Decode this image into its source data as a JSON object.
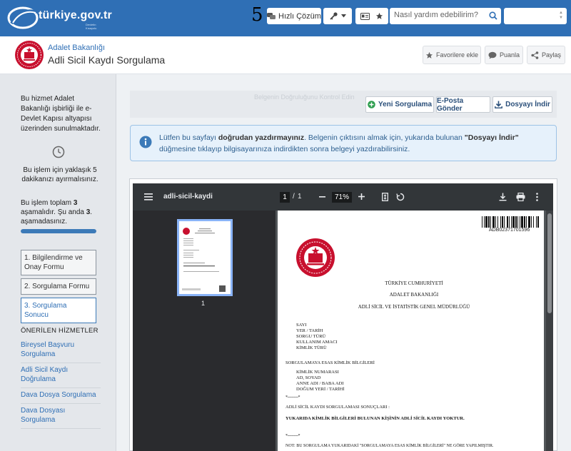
{
  "header": {
    "logo_text": "türkiye.gov.tr",
    "logo_sub": "Devletin Kısayolu",
    "step_number": "5",
    "hizli_cozum": "Hızlı Çözüm",
    "search_placeholder": "Nasıl yardım edebilirim?",
    "language": ""
  },
  "subheader": {
    "ministry": "Adalet Bakanlığı",
    "title": "Adli Sicil Kaydı Sorgulama",
    "favorites": "Favorilere ekle",
    "rate": "Puanla",
    "share": "Paylaş"
  },
  "sidebar": {
    "info": "Bu hizmet Adalet Bakanlığı işbirliği ile e-Devlet Kapısı altyapısı üzerinden sunulmaktadır.",
    "duration": "Bu işlem için yaklaşık 5 dakikanızı ayırmalısınız.",
    "stages_pre": "Bu işlem toplam ",
    "stages_total": "3",
    "stages_mid": " aşamalıdır. Şu anda ",
    "stages_current": "3",
    "stages_post": ". aşamadasınız.",
    "progress_percent": 100,
    "steps": [
      "1. Bilgilendirme ve Onay Formu",
      "2. Sorgulama Formu",
      "3. Sorgulama Sonucu"
    ],
    "recommended_title": "ÖNERİLEN HİZMETLER",
    "recommended": [
      "Bireysel Başvuru Sorgulama",
      "Adli Sicil Kaydı Doğrulama",
      "Dava Dosya Sorgulama",
      "Dava Dosyası Sorgulama"
    ]
  },
  "toolbar": {
    "ghost": "Belgenin Doğruluğunu Kontrol Edin",
    "new_query": "Yeni Sorgulama",
    "email": "E-Posta Gönder",
    "download": "Dosyayı İndir"
  },
  "alert": {
    "part1": "Lütfen bu sayfayı ",
    "bold1": "doğrudan yazdırmayınız",
    "part2": ". Belgenin çıktısını almak için, yukarıda bulunan ",
    "bold2": "\"Dosyayı İndir\"",
    "part3": " düğmesine tıklayıp bilgisayarınıza indirdikten sonra belgeyi yazdırabilirsiniz."
  },
  "pdf": {
    "filename": "adli-sicil-kaydi",
    "page": "1",
    "pages": "1",
    "zoom": "71%",
    "thumb_page": "1"
  },
  "document": {
    "barcode_number": "ADB02371701596",
    "line1": "TÜRKİYE CUMHURİYETİ",
    "line2": "ADALET BAKANLIĞI",
    "line3": "ADLİ SİCİL VE İSTATİSTİK GENEL MÜDÜRLÜĞÜ",
    "fields1": [
      "SAYI",
      "YER / TARİH",
      "SORGU TÜRÜ",
      "KULLANIM AMACI",
      "KİMLİK TÜRÜ"
    ],
    "section_title": "SORGULAMAYA ESAS KİMLİK BİLGİLERİ",
    "fields2": [
      "KİMLİK NUMARASI",
      "AD, SOYAD",
      "ANNE ADI / BABA ADI",
      "DOĞUM YERİ / TARİHİ"
    ],
    "results_title": "ADLİ SİCİL KAYDI SORGULAMASI SONUÇLARI :",
    "result_text": "YUKARIDA KİMLİK BİLGİLERİ BULUNAN KİŞİNİN ADLİ SİCİL KAYDI YOKTUR.",
    "note": "NOT: BU SORGULAMA YUKARIDAKİ \"SORGULAMAYA ESAS KİMLİK BİLGİLERİ\" NE GÖRE YAPILMIŞTIR.",
    "dashes": "*----------*"
  },
  "colors": {
    "brand_blue": "#2f6fb5",
    "emblem_red": "#c8102e",
    "green": "#2e9e4f",
    "progress": "#3c7ab8"
  },
  "icons": [
    "chat-icon",
    "key-icon",
    "id-card-icon",
    "star-icon",
    "search-icon",
    "emblem-icon",
    "clock-icon",
    "plus-circle-icon",
    "download-icon",
    "info-icon",
    "menu-icon",
    "print-icon",
    "more-icon"
  ]
}
